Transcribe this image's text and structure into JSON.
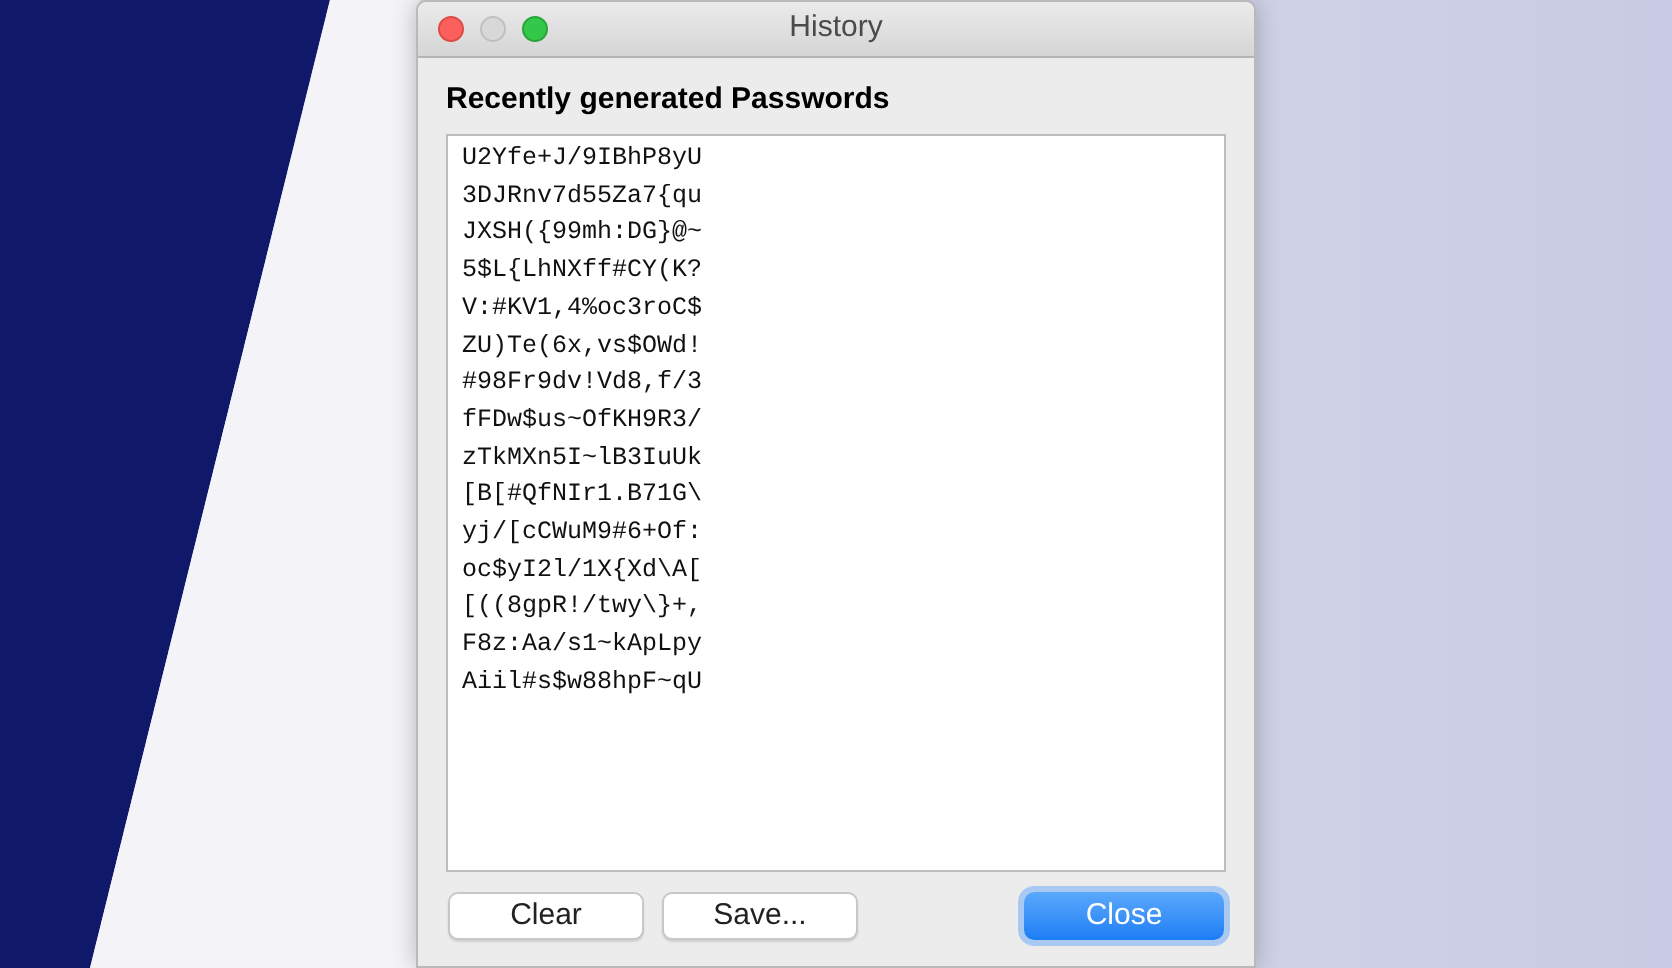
{
  "window": {
    "title": "History"
  },
  "heading": "Recently generated Passwords",
  "passwords": [
    "U2Yfe+J/9IBhP8yU",
    "3DJRnv7d55Za7{qu",
    "JXSH({99mh:DG}@~",
    "5$L{LhNXff#CY(K?",
    "V:#KV1,4%oc3roC$",
    "ZU)Te(6x,vs$OWd!",
    "#98Fr9dv!Vd8,f/3",
    "fFDw$us~OfKH9R3/",
    "zTkMXn5I~lB3IuUk",
    "[B[#QfNIr1.B71G\\",
    "yj/[cCWuM9#6+Of:",
    "oc$yI2l/1X{Xd\\A[",
    "[((8gpR!/twy\\}+,",
    "F8z:Aa/s1~kApLpy",
    "Aiil#s$w88hpF~qU"
  ],
  "buttons": [
    {
      "label": "Clear",
      "kind": "default"
    },
    {
      "label": "Save...",
      "kind": "default"
    },
    {
      "label": "Close",
      "kind": "primary"
    }
  ]
}
